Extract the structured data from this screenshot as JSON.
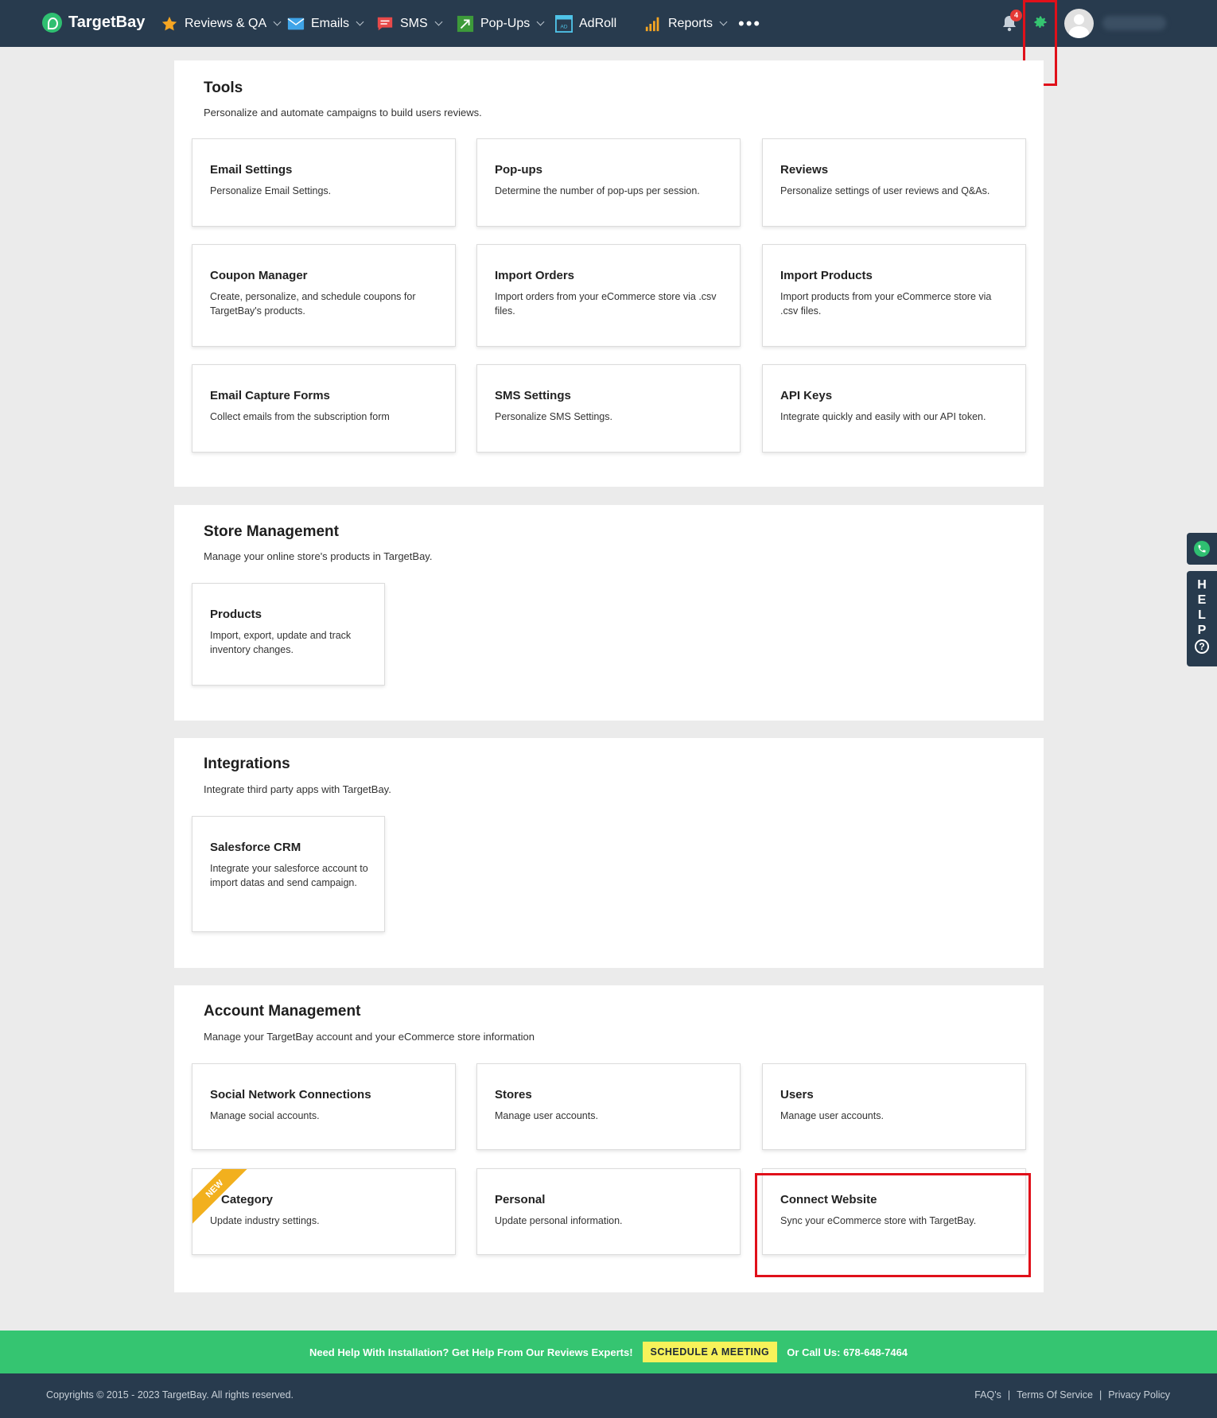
{
  "nav": {
    "brand": "TargetBay",
    "items": [
      {
        "label": "Reviews & QA",
        "icon": "star-icon",
        "dropdown": true
      },
      {
        "label": "Emails",
        "icon": "envelope-icon",
        "dropdown": true
      },
      {
        "label": "SMS",
        "icon": "chat-icon",
        "dropdown": true
      },
      {
        "label": "Pop-Ups",
        "icon": "popup-arrow-icon",
        "dropdown": true
      },
      {
        "label": "AdRoll",
        "icon": "adroll-icon",
        "dropdown": false
      },
      {
        "label": "Reports",
        "icon": "bar-chart-icon",
        "dropdown": true
      }
    ],
    "more": "•••",
    "notification_count": "4"
  },
  "sections": {
    "tools": {
      "title": "Tools",
      "subtitle": "Personalize and automate campaigns to build users reviews.",
      "cards": [
        {
          "title": "Email Settings",
          "desc": "Personalize Email Settings."
        },
        {
          "title": "Pop-ups",
          "desc": "Determine the number of pop-ups per session."
        },
        {
          "title": "Reviews",
          "desc": "Personalize settings of user reviews and Q&As."
        },
        {
          "title": "Coupon Manager",
          "desc": "Create, personalize, and schedule coupons for TargetBay's products."
        },
        {
          "title": "Import Orders",
          "desc": "Import orders from your eCommerce store via .csv files."
        },
        {
          "title": "Import Products",
          "desc": "Import products from your eCommerce store via .csv files."
        },
        {
          "title": "Email Capture Forms",
          "desc": "Collect emails from the subscription form"
        },
        {
          "title": "SMS Settings",
          "desc": "Personalize SMS Settings."
        },
        {
          "title": "API Keys",
          "desc": "Integrate quickly and easily with our API token."
        }
      ]
    },
    "store": {
      "title": "Store Management",
      "subtitle": "Manage your online store's products in TargetBay.",
      "cards": [
        {
          "title": "Products",
          "desc": "Import, export, update and track inventory changes."
        }
      ]
    },
    "integrations": {
      "title": "Integrations",
      "subtitle": "Integrate third party apps with TargetBay.",
      "cards": [
        {
          "title": "Salesforce CRM",
          "desc": "Integrate your salesforce account to import datas and send campaign."
        }
      ]
    },
    "account": {
      "title": "Account Management",
      "subtitle": "Manage your TargetBay account and your eCommerce store information",
      "cards": [
        {
          "title": "Social Network Connections",
          "desc": "Manage social accounts."
        },
        {
          "title": "Stores",
          "desc": "Manage user accounts."
        },
        {
          "title": "Users",
          "desc": "Manage user accounts."
        },
        {
          "title": "Category",
          "desc": "Update industry settings.",
          "ribbon": "NEW"
        },
        {
          "title": "Personal",
          "desc": "Update personal information."
        },
        {
          "title": "Connect Website",
          "desc": "Sync your eCommerce store with TargetBay."
        }
      ]
    }
  },
  "help": {
    "letters": [
      "H",
      "E",
      "L",
      "P"
    ],
    "question": "?"
  },
  "cta": {
    "text": "Need Help With Installation? Get Help From Our Reviews Experts!",
    "button": "SCHEDULE A MEETING",
    "phone": "Or Call Us: 678-648-7464"
  },
  "footer": {
    "copyright": "Copyrights © 2015 - 2023 TargetBay. All rights reserved.",
    "links": [
      "FAQ's",
      "Terms Of Service",
      "Privacy Policy"
    ]
  },
  "colors": {
    "nav_bg": "#283b4e",
    "accent_green": "#35c571",
    "highlight_red": "#e0101a",
    "ribbon_yellow": "#f2b01e"
  }
}
